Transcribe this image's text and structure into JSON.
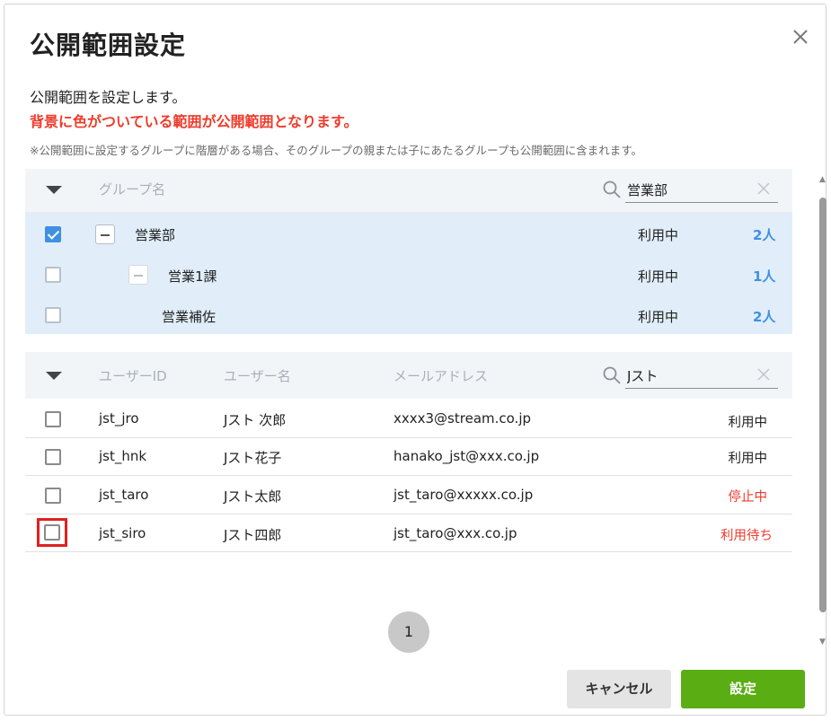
{
  "dialog": {
    "title": "公開範囲設定",
    "description": "公開範囲を設定します。",
    "warning": "背景に色がついている範囲が公開範囲となります。",
    "note": "※公開範囲に設定するグループに階層がある場合、そのグループの親または子にあたるグループも公開範囲に含まれます。",
    "colors": {
      "warning": "#ee3b2b",
      "accent": "#3f8fe3",
      "primary_button": "#5aad13",
      "selected_bg": "#e1eef9"
    }
  },
  "group_panel": {
    "column_header": "グループ名",
    "search_value": "営業部",
    "rows": [
      {
        "name": "営業部",
        "status": "利用中",
        "count": "2人",
        "checked": true
      },
      {
        "name": "営業1課",
        "status": "利用中",
        "count": "1人",
        "checked": false
      },
      {
        "name": "営業補佐",
        "status": "利用中",
        "count": "2人",
        "checked": false
      }
    ]
  },
  "user_panel": {
    "headers": {
      "user_id": "ユーザーID",
      "user_name": "ユーザー名",
      "email": "メールアドレス"
    },
    "search_value": "Jスト",
    "rows": [
      {
        "id": "jst_jro",
        "name": "Jスト 次郎",
        "email": "xxxx3@stream.co.jp",
        "status": "利用中",
        "status_color": "#222222",
        "checked": false
      },
      {
        "id": "jst_hnk",
        "name": "Jスト花子",
        "email": "hanako_jst@xxx.co.jp",
        "status": "利用中",
        "status_color": "#222222",
        "checked": false
      },
      {
        "id": "jst_taro",
        "name": "Jスト太郎",
        "email": "jst_taro@xxxxx.co.jp",
        "status": "停止中",
        "status_color": "#ee3b2b",
        "checked": false
      },
      {
        "id": "jst_siro",
        "name": "Jスト四郎",
        "email": "jst_taro@xxx.co.jp",
        "status": "利用待ち",
        "status_color": "#ee3b2b",
        "checked": false
      }
    ]
  },
  "pagination": {
    "current_page": "1"
  },
  "footer": {
    "cancel_label": "キャンセル",
    "confirm_label": "設定"
  }
}
